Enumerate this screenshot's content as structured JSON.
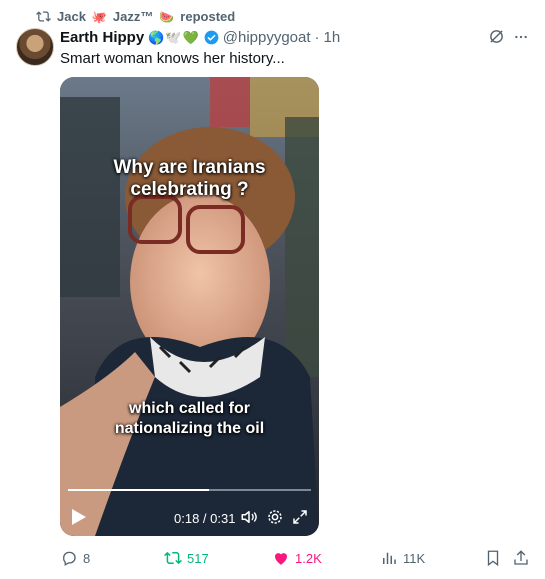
{
  "repost": {
    "user": "Jack",
    "emoji_1": "🐙",
    "jazz": "Jazz™",
    "emoji_2": "🍉",
    "suffix": "reposted"
  },
  "author": {
    "name": "Earth Hippy",
    "emojis": "🌎🕊️💚",
    "handle": "@hippyygoat",
    "separator": "·",
    "time": "1h"
  },
  "tweet": {
    "text": "Smart woman knows her history..."
  },
  "video": {
    "caption_top_line1": "Why are Iranians",
    "caption_top_line2": "celebrating ?",
    "caption_bottom_line1": "which called for",
    "caption_bottom_line2": "nationalizing the oil",
    "time": "0:18 / 0:31",
    "progress": 0.58
  },
  "actions": {
    "replies": "8",
    "reposts": "517",
    "likes": "1.2K",
    "views": "11K"
  },
  "colors": {
    "repost_green": "#00ba7c",
    "like_pink": "#f91880",
    "verified_blue": "#1d9bf0",
    "muted": "#536471"
  }
}
